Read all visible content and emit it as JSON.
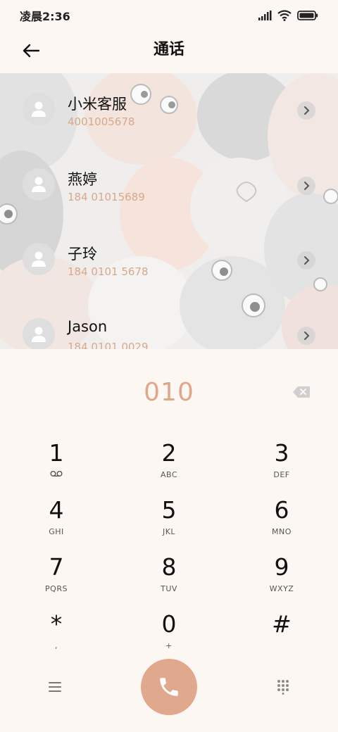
{
  "status_bar": {
    "time": "凌晨2:36",
    "icons": [
      "signal-icon",
      "wifi-icon",
      "battery-icon"
    ]
  },
  "header": {
    "title": "通话",
    "back_icon": "back-arrow-icon"
  },
  "contacts": [
    {
      "name": "小米客服",
      "number": "4001005678"
    },
    {
      "name": "燕婷",
      "number": "184 01015689"
    },
    {
      "name": "子玲",
      "number": "184 0101 5678"
    },
    {
      "name": "Jason",
      "number": "184 0101 0029"
    }
  ],
  "dialer": {
    "input": "010",
    "backspace_icon": "backspace-icon"
  },
  "keypad": [
    {
      "digit": "1",
      "letters": "",
      "sub_icon": "voicemail-icon"
    },
    {
      "digit": "2",
      "letters": "ABC"
    },
    {
      "digit": "3",
      "letters": "DEF"
    },
    {
      "digit": "4",
      "letters": "GHI"
    },
    {
      "digit": "5",
      "letters": "JKL"
    },
    {
      "digit": "6",
      "letters": "MNO"
    },
    {
      "digit": "7",
      "letters": "PQRS"
    },
    {
      "digit": "8",
      "letters": "TUV"
    },
    {
      "digit": "9",
      "letters": "WXYZ"
    },
    {
      "digit": "*",
      "letters": ","
    },
    {
      "digit": "0",
      "letters": "+"
    },
    {
      "digit": "#",
      "letters": ""
    }
  ],
  "bottom_bar": {
    "menu_icon": "menu-icon",
    "call_icon": "phone-icon",
    "dialpad_icon": "dialpad-icon"
  },
  "colors": {
    "background": "#fdf7f4",
    "accent": "#e0a98e",
    "number_text": "#d8a889",
    "dial_text": "#dfa68a"
  }
}
